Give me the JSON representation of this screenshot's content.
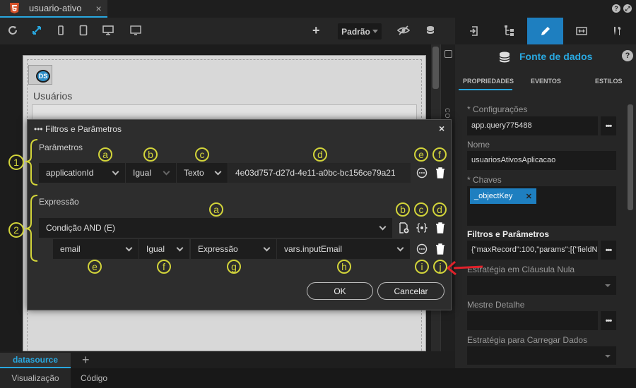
{
  "file_tab": {
    "name": "usuario-ativo",
    "close": "×"
  },
  "toolbar": {
    "device_select": "Padrão",
    "add": "+"
  },
  "canvas": {
    "ds_badge": "DS",
    "usuarios_label": "Usuários",
    "controls_strip": "CONTROLES"
  },
  "bottom": {
    "datasource_tab": "datasource",
    "add_tab": "+",
    "visual_tab": "Visualização",
    "code_tab": "Código"
  },
  "right_panel": {
    "title": "Fonte de dados",
    "help": "?",
    "subtabs": [
      "PROPRIEDADES",
      "EVENTOS",
      "ESTILOS"
    ],
    "configuracoes_label": "* Configurações",
    "configuracoes_value": "app.query775488",
    "nome_label": "Nome",
    "nome_value": "usuariosAtivosAplicacao",
    "chaves_label": "* Chaves",
    "chaves_chip": "_objectKey",
    "chaves_chip_remove": "✕",
    "filtros_label": "Filtros e Parâmetros",
    "filtros_value": "{\"maxRecord\":100,\"params\":[{\"fieldN",
    "estrategia_nula_label": "Estratégia em Cláusula Nula",
    "mestre_label": "Mestre Detalhe",
    "estrategia_carregar_label": "Estratégia para Carregar Dados",
    "dots": "•••"
  },
  "dialog": {
    "title": "••• Filtros e Parâmetros",
    "close": "×",
    "params_label": "Parâmetros",
    "param_row": {
      "field": "applicationId",
      "operator": "Igual",
      "type": "Texto",
      "value": "4e03d757-d27d-4e11-a0bc-bc156ce79a21"
    },
    "expr_label": "Expressão",
    "condition": "Condição AND (E)",
    "expr_row": {
      "field": "email",
      "operator": "Igual",
      "type": "Expressão",
      "value": "vars.inputEmail"
    },
    "ok": "OK",
    "cancel": "Cancelar"
  },
  "annotations": {
    "n1": "1",
    "n2": "2",
    "pa": "a",
    "pb": "b",
    "pc": "c",
    "pd": "d",
    "pe": "e",
    "pf": "f",
    "ea": "a",
    "eb": "b",
    "ec": "c",
    "ed": "d",
    "ee": "e",
    "ef": "f",
    "eg": "g",
    "eh": "h",
    "ei": "i",
    "ej": "j"
  },
  "colors": {
    "accent": "#29a8e0",
    "annotation": "#d2d43a",
    "arrow": "#e0212a"
  }
}
